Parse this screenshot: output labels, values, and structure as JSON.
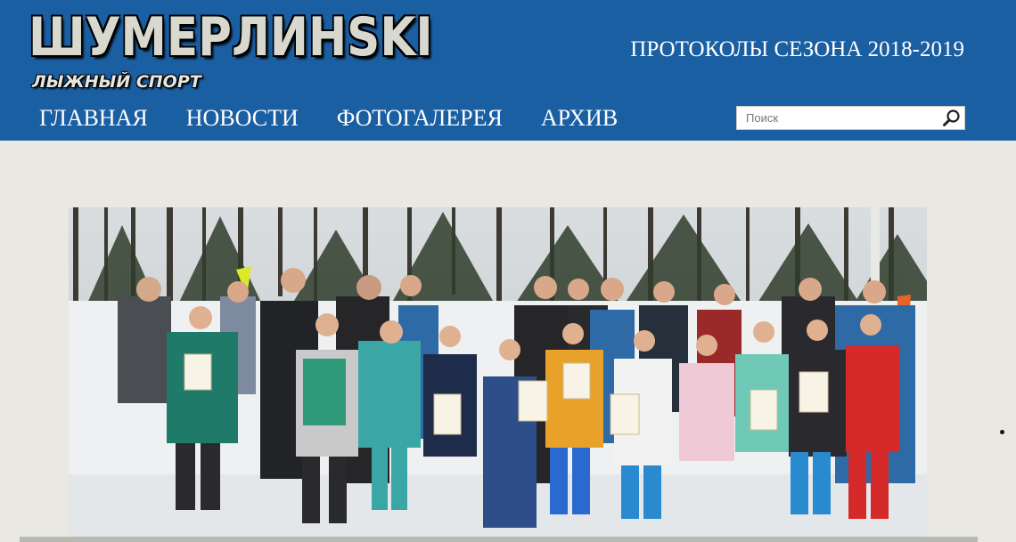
{
  "header": {
    "logo_main": "ШУМЕРЛИНSKI",
    "logo_sub": "ЛЫЖНЫЙ СПОРТ",
    "season_link": "ПРОТОКОЛЫ СЕЗОНА 2018-2019",
    "nav": [
      {
        "label": "ГЛАВНАЯ"
      },
      {
        "label": "НОВОСТИ"
      },
      {
        "label": "ФОТОГАЛЕРЕЯ"
      },
      {
        "label": "АРХИВ"
      }
    ],
    "search": {
      "placeholder": "Поиск",
      "icon": "search-icon"
    }
  },
  "colors": {
    "header_bg": "#1b5fa3",
    "page_bg": "#e9e8e2",
    "nav_text": "#ffffff"
  },
  "hero": {
    "description_icon": "group-photo"
  }
}
